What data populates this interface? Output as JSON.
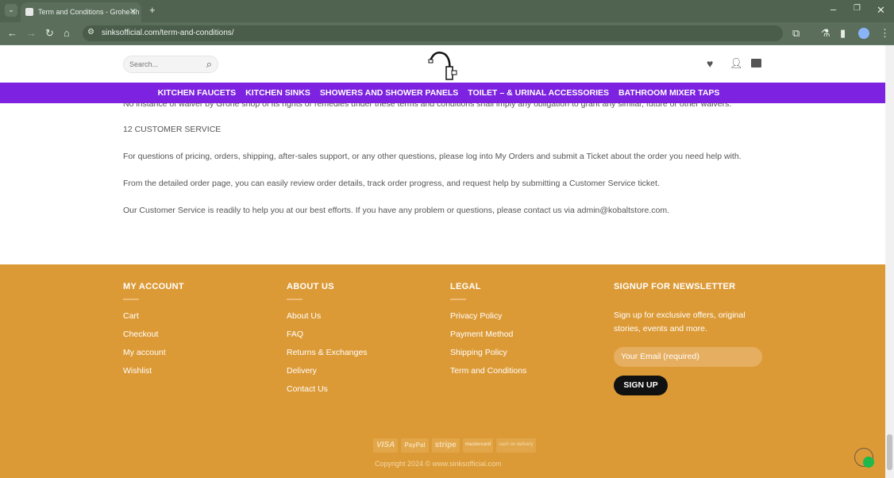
{
  "browser": {
    "tab_title": "Term and Conditions - Grohe sh",
    "url": "sinksofficial.com/term-and-conditions/"
  },
  "header": {
    "search_placeholder": "Search..."
  },
  "nav": [
    "KITCHEN FAUCETS",
    "KITCHEN SINKS",
    "SHOWERS AND SHOWER PANELS",
    "TOILET – & URINAL ACCESSORIES",
    "BATHROOM MIXER TAPS"
  ],
  "content": {
    "partial": "No instance of waiver by Grohe shop of its rights or remedies under these terms and conditions shall imply any obligation to grant any similar, future or other waivers.",
    "heading": "12 CUSTOMER SERVICE",
    "paragraphs": [
      "For questions of pricing, orders, shipping, after-sales support, or any other questions, please log into My Orders and submit a Ticket about the order you need help with.",
      "From the detailed order page, you can easily review order details, track order progress, and request help by submitting a Customer Service ticket.",
      "Our Customer Service is readily to help you at our best efforts. If you have any problem or questions, please contact us via admin@kobaltstore.com."
    ]
  },
  "footer": {
    "columns": [
      {
        "title": "MY ACCOUNT",
        "links": [
          "Cart",
          "Checkout",
          "My account",
          "Wishlist"
        ]
      },
      {
        "title": "ABOUT US",
        "links": [
          "About Us",
          "FAQ",
          "Returns & Exchanges",
          "Delivery",
          "Contact Us"
        ]
      },
      {
        "title": "LEGAL",
        "links": [
          "Privacy Policy",
          "Payment Method",
          "Shipping Policy",
          "Term and Conditions"
        ]
      }
    ],
    "newsletter": {
      "title": "SIGNUP FOR NEWSLETTER",
      "text": "Sign up for exclusive offers, original stories, events and more.",
      "placeholder": "Your Email (required)",
      "button": "SIGN UP"
    },
    "payments": [
      "VISA",
      "PayPal",
      "stripe",
      "mastercard",
      "cash on delivery"
    ],
    "copyright": "Copyright 2024 © www.sinksofficial.com"
  },
  "colors": {
    "nav": "#7d22e0",
    "footer": "#dc9a36"
  }
}
